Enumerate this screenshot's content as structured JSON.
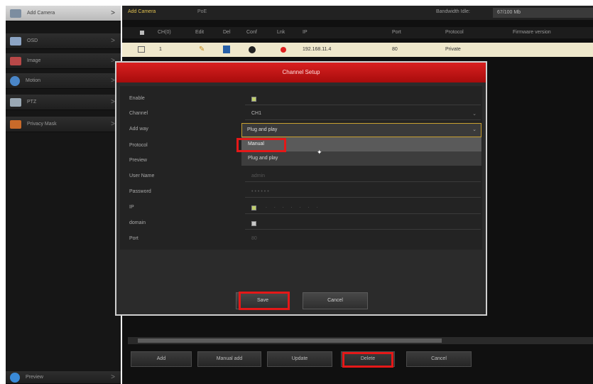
{
  "sidebar": {
    "items": [
      {
        "label": "Add Camera",
        "icon": "camera-icon",
        "active": true
      },
      {
        "label": "OSD",
        "icon": "osd-icon"
      },
      {
        "label": "Image",
        "icon": "image-icon"
      },
      {
        "label": "Motion",
        "icon": "motion-icon"
      },
      {
        "label": "PTZ",
        "icon": "ptz-icon"
      },
      {
        "label": "Privacy Mask",
        "icon": "privacy-mask-icon"
      }
    ],
    "bottom_item": {
      "label": "Preview",
      "icon": "preview-icon"
    }
  },
  "tabs": [
    "Add Camera",
    "PoE"
  ],
  "bandwidth": {
    "label": "Bandwidth Idle:",
    "value": "67/100 Mb"
  },
  "table": {
    "columns": [
      "CH(0)",
      "Edit",
      "Del",
      "Conf",
      "Lnk",
      "IP",
      "Port",
      "Protocol",
      "Firmware version"
    ],
    "rows": [
      {
        "ch": "1",
        "ip": "192.168.11.4",
        "port": "80",
        "protocol": "Private"
      }
    ]
  },
  "bottom_buttons": [
    "Add",
    "Manual add",
    "Update",
    "Delete",
    "Cancel"
  ],
  "dialog": {
    "title": "Channel Setup",
    "fields": {
      "enable": "Enable",
      "channel": "Channel",
      "channel_value": "CH1",
      "add_way": "Add way",
      "protocol": "Protocol",
      "preview": "Preview",
      "user_name": "User Name",
      "user_name_value": "admin",
      "password": "Password",
      "ip": "IP",
      "domain": "domain",
      "port": "Port",
      "port_value": "80"
    },
    "add_way_selected": "Plug and play",
    "add_way_options": [
      "Manual",
      "Plug and play"
    ],
    "save_label": "Save",
    "cancel_label": "Cancel"
  },
  "colors": {
    "accent_red": "#e41818",
    "title_bar": "#c41414",
    "row_highlight": "#efe8cc",
    "active_tab": "#e0c050"
  }
}
